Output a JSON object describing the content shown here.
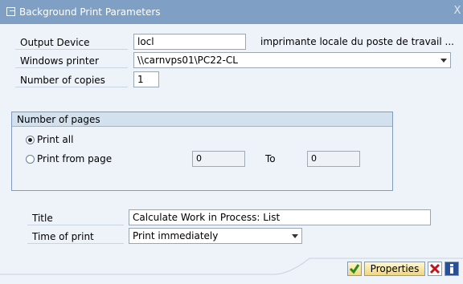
{
  "window": {
    "title": "Background Print Parameters",
    "close_glyph": "X"
  },
  "form": {
    "output_device": {
      "label": "Output Device",
      "value": "locl",
      "description": "imprimante locale du poste de travail ..."
    },
    "windows_printer": {
      "label": "Windows printer",
      "value": "\\\\carnvps01\\PC22-CL"
    },
    "copies": {
      "label": "Number of copies",
      "value": "1"
    }
  },
  "pages_group": {
    "title": "Number of pages",
    "print_all_label": "Print all",
    "print_from_label": "Print from page",
    "from_value": "0",
    "to_label": "To",
    "to_value": "0",
    "selected": "print_all"
  },
  "bottom": {
    "title": {
      "label": "Title",
      "value": "Calculate Work in Process: List"
    },
    "time": {
      "label": "Time of print",
      "value": "Print immediately"
    }
  },
  "toolbar": {
    "properties_label": "Properties"
  },
  "icons": {
    "confirm": "check-icon",
    "cancel": "cross-icon",
    "info": "info-icon"
  },
  "colors": {
    "titlebar": "#7fa0c4",
    "panel": "#eef3f9",
    "group_header": "#d3e0ee",
    "button": "#f0d680"
  }
}
